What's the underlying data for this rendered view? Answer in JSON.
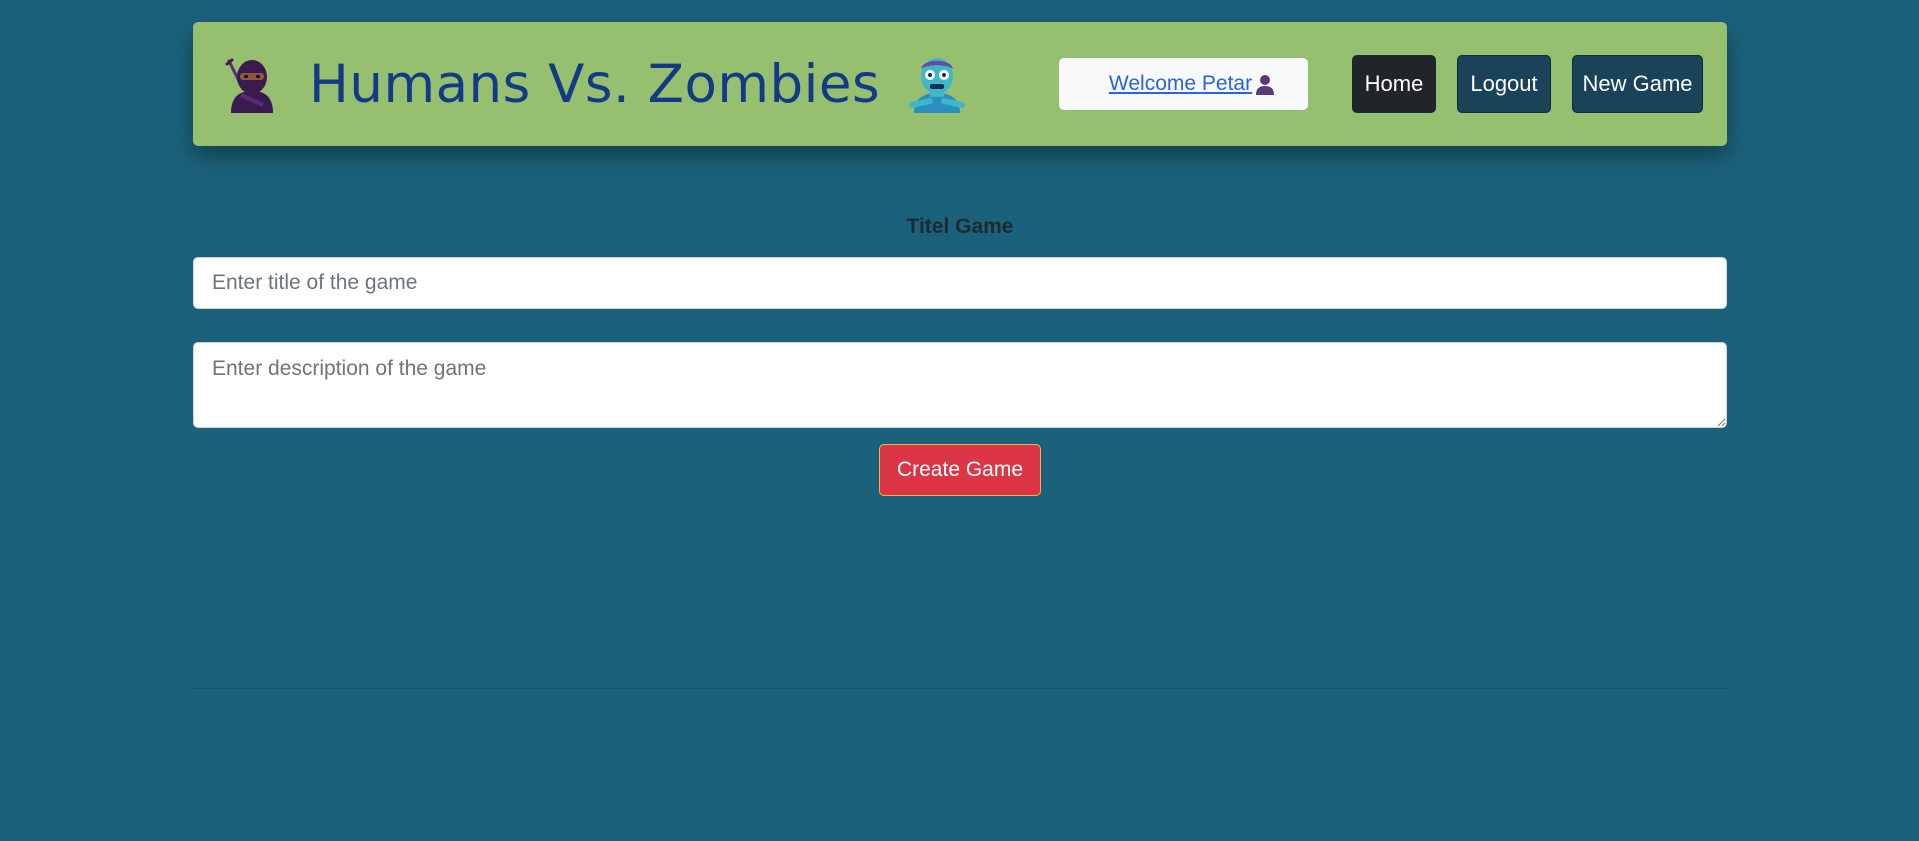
{
  "header": {
    "title": "Humans Vs. Zombies",
    "welcome_text": "Welcome Petar",
    "nav": {
      "home": "Home",
      "logout": "Logout",
      "new_game": "New Game"
    }
  },
  "form": {
    "label": "Titel Game",
    "title_placeholder": "Enter title of the game",
    "title_value": "",
    "description_placeholder": "Enter description of the game",
    "description_value": "",
    "submit_label": "Create Game"
  },
  "colors": {
    "background": "#1b617b",
    "navbar": "#96bf70",
    "brand_text": "#133a86",
    "link": "#2a63df",
    "home_button": "#212529",
    "nav_button": "#1a4258",
    "create_button": "#dc3545"
  },
  "icons": {
    "left_brand": "ninja-icon",
    "right_brand": "zombie-icon",
    "welcome": "user-icon"
  }
}
